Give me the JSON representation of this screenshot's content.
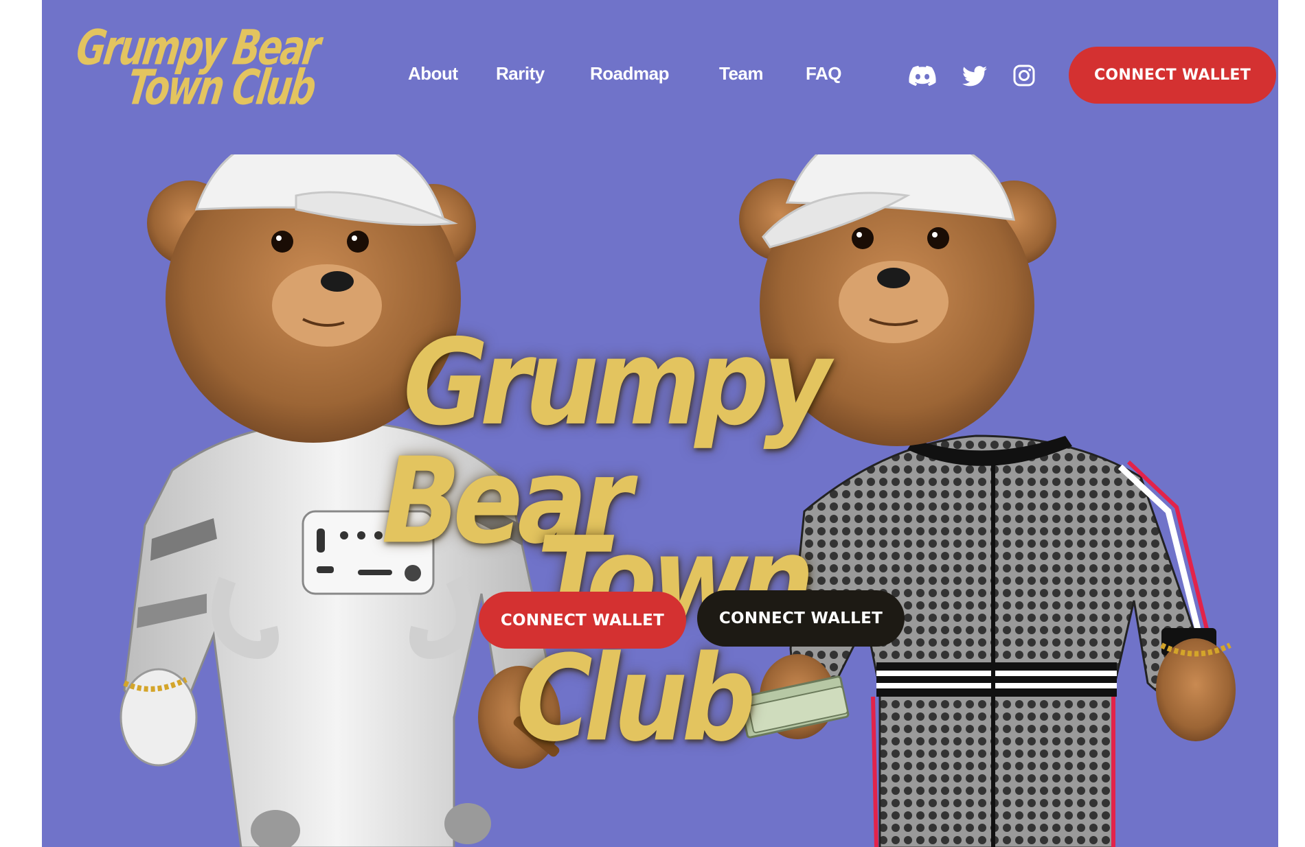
{
  "brand": {
    "logo_line1": "Grumpy Bear",
    "logo_line2": "Town Club"
  },
  "nav": {
    "items": [
      {
        "label": "About"
      },
      {
        "label": "Rarity"
      },
      {
        "label": "Roadmap"
      },
      {
        "label": "Team"
      },
      {
        "label": "FAQ"
      }
    ]
  },
  "social": {
    "icons": [
      "discord-icon",
      "twitter-icon",
      "instagram-icon"
    ]
  },
  "header": {
    "connect_label": "CONNECT WALLET"
  },
  "hero": {
    "title_line1": "Grumpy Bear",
    "title_line2": "Town Club",
    "primary_button": "CONNECT WALLET",
    "secondary_button": "CONNECT WALLET"
  },
  "colors": {
    "background": "#7073c9",
    "gold": "#e3c45f",
    "red": "#d43131",
    "dark": "#1d1a14"
  }
}
